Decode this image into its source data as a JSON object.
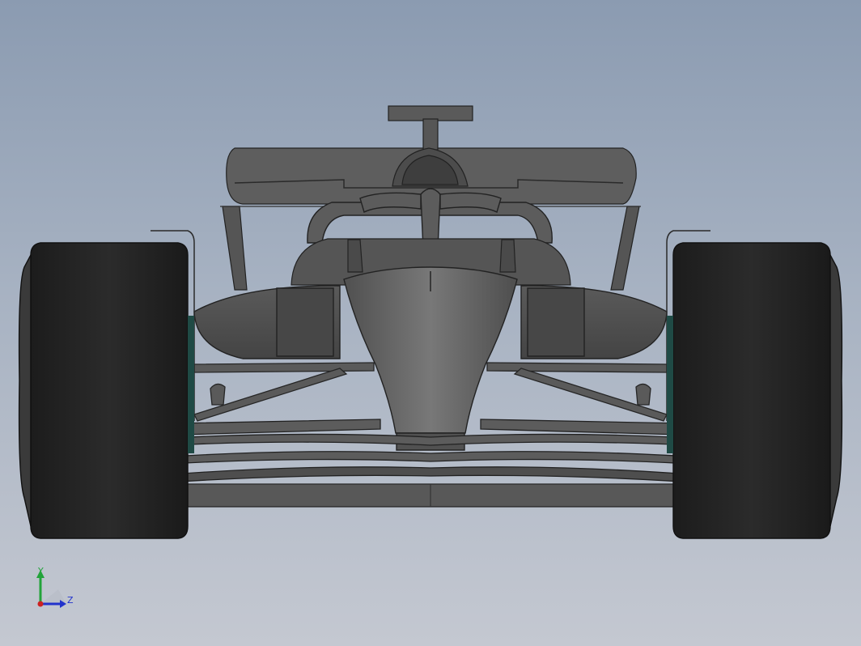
{
  "viewport": {
    "background_top": "#8b9bb1",
    "background_bottom": "#c4c8d1"
  },
  "model": {
    "name": "formula-1-car",
    "view": "front"
  },
  "triad": {
    "y_label": "Y",
    "z_label": "Z",
    "y_color": "#22a33a",
    "z_color": "#2233cc",
    "x_color": "#cc2222"
  }
}
